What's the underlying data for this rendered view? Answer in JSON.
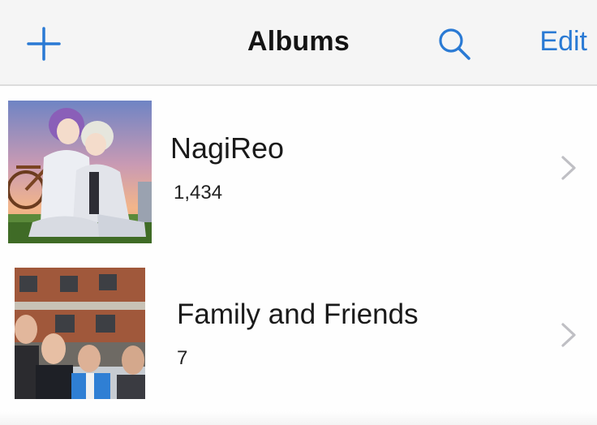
{
  "navbar": {
    "title": "Albums",
    "edit_label": "Edit",
    "add_icon": "plus-icon",
    "search_icon": "search-icon",
    "accent_color": "#2a7ad4"
  },
  "albums": [
    {
      "name": "NagiReo",
      "count": "1,434",
      "thumbnail": "anime-characters-sunset-photo"
    },
    {
      "name": "Family and Friends",
      "count": "7",
      "thumbnail": "group-in-front-of-building-photo"
    }
  ]
}
